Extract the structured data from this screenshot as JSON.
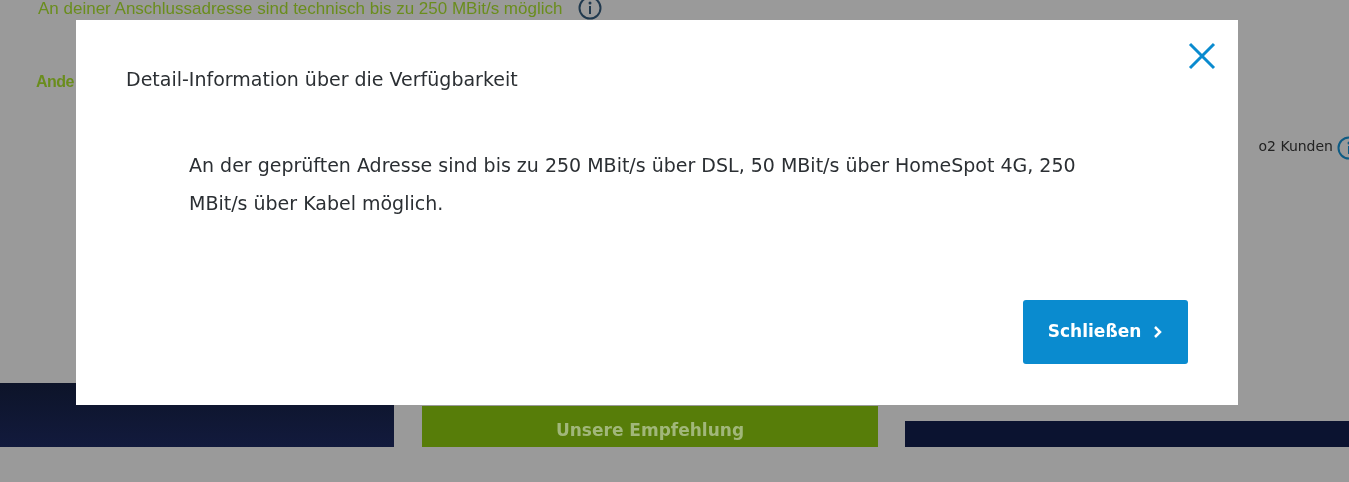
{
  "page": {
    "availability_text": "An deiner Anschlussadresse sind technisch bis zu 250 MBit/s möglich",
    "other_link": "Ande",
    "customer_label": "o2 Kunden",
    "recommendation_banner": "Unsere Empfehlung"
  },
  "dialog": {
    "title": "Detail-Information über die Verfügbarkeit",
    "message": "An der geprüften Adresse sind bis zu 250 MBit/s über DSL, 50 MBit/s über HomeSpot 4G, 250 MBit/s über Kabel möglich.",
    "close_button": "Schließen"
  }
}
